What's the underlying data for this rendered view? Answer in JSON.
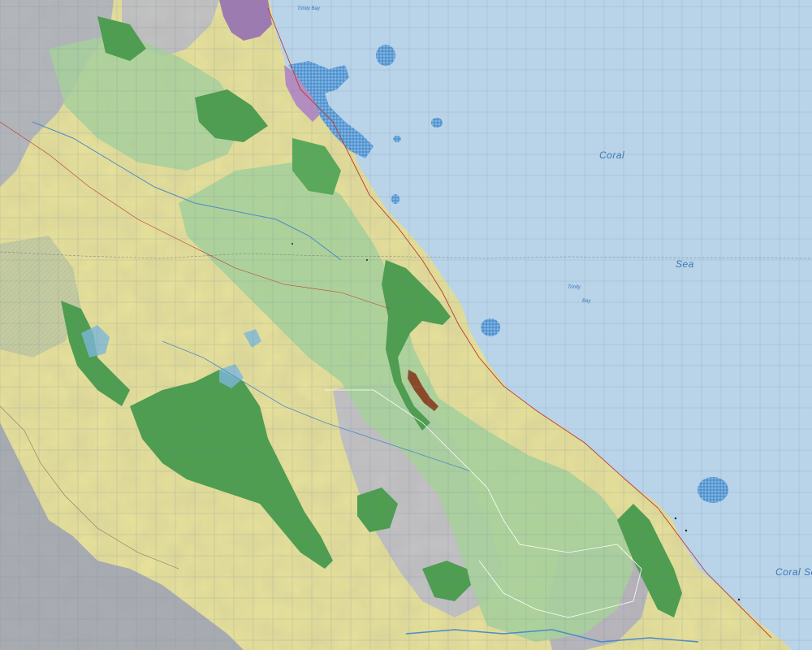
{
  "map": {
    "water_labels": {
      "coral": "Coral",
      "sea": "Sea",
      "coral_sea": "Coral Sea",
      "bay_a": "Trinity",
      "bay_b": "Bay",
      "bay_top": "Trinity Bay"
    },
    "colors": {
      "sea": "#b9d3e9",
      "grid": "#6f88a8",
      "land_yellow": "#e8e29a",
      "park_green_light": "#a7cf9b",
      "forest_green": "#4e9d50",
      "grey_terrain": "#b4b8bd",
      "lake_blue": "#6ea6d8",
      "urban_purple": "#9d7bb0",
      "mangrove_brown": "#8a4a2a"
    }
  }
}
